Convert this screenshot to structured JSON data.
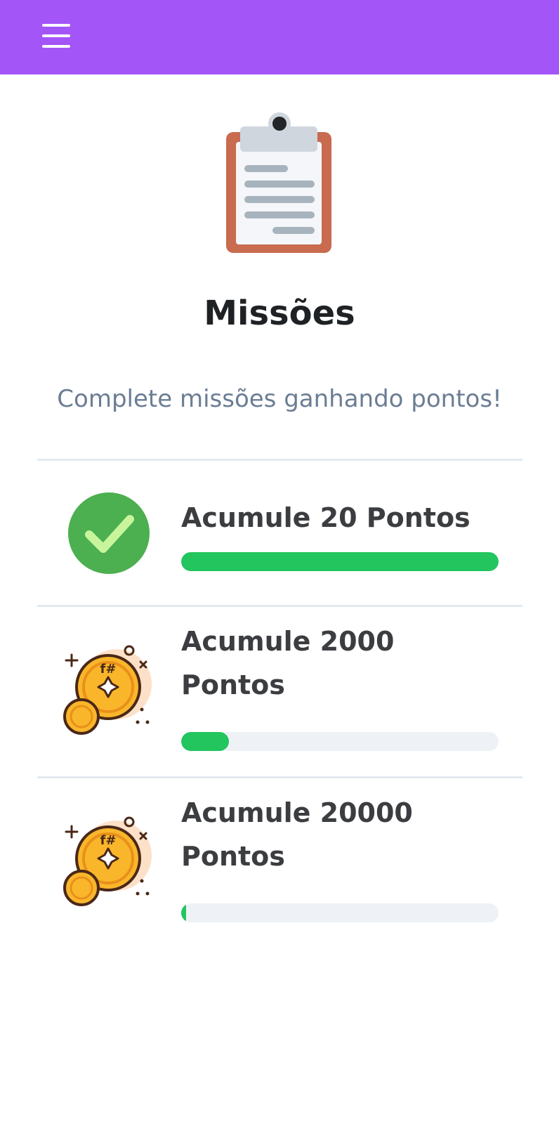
{
  "header": {
    "menu_icon": "hamburger-menu-icon",
    "background_color": "#a355f7"
  },
  "hero": {
    "icon": "clipboard-icon",
    "title": "Missões",
    "subtitle": "Complete missões ganhando pontos!"
  },
  "missions": [
    {
      "title": "Acumule 20 Pontos",
      "icon": "check-circle-icon",
      "progress": 1.0,
      "completed": true
    },
    {
      "title": "Acumule 2000 Pontos",
      "icon": "coins-icon",
      "progress": 0.15,
      "completed": false
    },
    {
      "title": "Acumule 20000 Pontos",
      "icon": "coins-icon",
      "progress": 0.015,
      "completed": false
    }
  ],
  "colors": {
    "accent": "#a355f7",
    "progress": "#22c55e",
    "track": "#eef2f6",
    "check": "#4caf50"
  }
}
